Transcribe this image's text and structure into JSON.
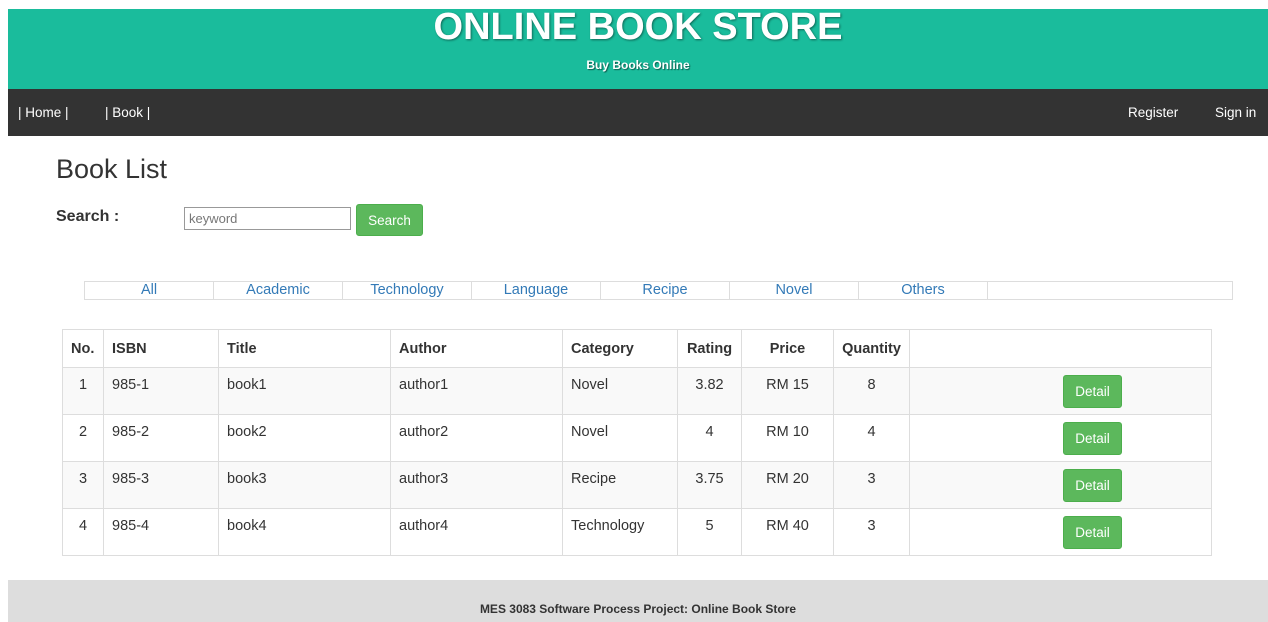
{
  "header": {
    "title": "ONLINE BOOK STORE",
    "subtitle": "Buy Books Online",
    "background": "#1abc9c"
  },
  "nav": {
    "home": "| Home |",
    "book": "| Book |",
    "register": "Register",
    "signin": "Sign in",
    "background": "#333333"
  },
  "main": {
    "page_title": "Book List",
    "search_label": "Search :",
    "search_placeholder": "keyword",
    "search_button": "Search"
  },
  "categories": [
    "All",
    "Academic",
    "Technology",
    "Language",
    "Recipe",
    "Novel",
    "Others"
  ],
  "table": {
    "headers": {
      "no": "No.",
      "isbn": "ISBN",
      "title": "Title",
      "author": "Author",
      "category": "Category",
      "rating": "Rating",
      "price": "Price",
      "quantity": "Quantity"
    },
    "rows": [
      {
        "no": "1",
        "isbn": "985-1",
        "title": "book1",
        "author": "author1",
        "category": "Novel",
        "rating": "3.82",
        "price": "RM 15",
        "quantity": "8",
        "action": "Detail"
      },
      {
        "no": "2",
        "isbn": "985-2",
        "title": "book2",
        "author": "author2",
        "category": "Novel",
        "rating": "4",
        "price": "RM 10",
        "quantity": "4",
        "action": "Detail"
      },
      {
        "no": "3",
        "isbn": "985-3",
        "title": "book3",
        "author": "author3",
        "category": "Recipe",
        "rating": "3.75",
        "price": "RM 20",
        "quantity": "3",
        "action": "Detail"
      },
      {
        "no": "4",
        "isbn": "985-4",
        "title": "book4",
        "author": "author4",
        "category": "Technology",
        "rating": "5",
        "price": "RM 40",
        "quantity": "3",
        "action": "Detail"
      }
    ]
  },
  "footer": {
    "text": "MES 3083 Software Process Project: Online Book Store"
  },
  "colors": {
    "accent_green": "#5cb85c",
    "link_blue": "#337ab7"
  }
}
